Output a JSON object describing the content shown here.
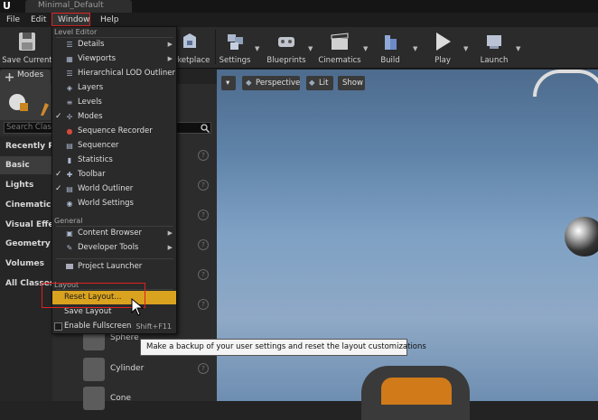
{
  "title_bar": {
    "logo": "U",
    "title": "Minimal_Default"
  },
  "menu": {
    "file": "File",
    "edit": "Edit",
    "window": "Window",
    "help": "Help"
  },
  "toolbar": {
    "save_current": "Save Current",
    "marketplace": "arketplace",
    "settings": "Settings",
    "blueprints": "Blueprints",
    "cinematics": "Cinematics",
    "build": "Build",
    "play": "Play",
    "launch": "Launch"
  },
  "modes": {
    "tab_label": "Modes",
    "search_placeholder": "Search Class",
    "categories": [
      "Recently Pla",
      "Basic",
      "Lights",
      "Cinematic",
      "Visual Effe",
      "Geometry",
      "Volumes",
      "All Classes"
    ],
    "items": [
      "Sphere",
      "Cylinder",
      "Cone"
    ]
  },
  "viewport": {
    "perspective": "Perspective",
    "lit": "Lit",
    "show": "Show"
  },
  "window_menu": {
    "level_editor_header": "Level Editor",
    "level_editor_items": [
      {
        "label": "Details",
        "checked": false,
        "submenu": true,
        "icon": "details-icon"
      },
      {
        "label": "Viewports",
        "checked": false,
        "submenu": true,
        "icon": "viewports-icon"
      },
      {
        "label": "Hierarchical LOD Outliner",
        "checked": false,
        "submenu": false,
        "icon": "hlod-icon"
      },
      {
        "label": "Layers",
        "checked": false,
        "submenu": false,
        "icon": "layers-icon"
      },
      {
        "label": "Levels",
        "checked": false,
        "submenu": false,
        "icon": "levels-icon"
      },
      {
        "label": "Modes",
        "checked": true,
        "submenu": false,
        "icon": "modes-icon"
      },
      {
        "label": "Sequence Recorder",
        "checked": false,
        "submenu": false,
        "icon": "record-icon"
      },
      {
        "label": "Sequencer",
        "checked": false,
        "submenu": false,
        "icon": "sequencer-icon"
      },
      {
        "label": "Statistics",
        "checked": false,
        "submenu": false,
        "icon": "statistics-icon"
      },
      {
        "label": "Toolbar",
        "checked": true,
        "submenu": false,
        "icon": "toolbar-icon"
      },
      {
        "label": "World Outliner",
        "checked": true,
        "submenu": false,
        "icon": "outliner-icon"
      },
      {
        "label": "World Settings",
        "checked": false,
        "submenu": false,
        "icon": "world-settings-icon"
      }
    ],
    "general_header": "General",
    "general_items": [
      {
        "label": "Content Browser",
        "submenu": true,
        "icon": "content-browser-icon"
      },
      {
        "label": "Developer Tools",
        "submenu": true,
        "icon": "developer-tools-icon"
      }
    ],
    "project_launcher": "Project Launcher",
    "layout_header": "Layout",
    "reset_layout": "Reset Layout...",
    "save_layout": "Save Layout",
    "enable_fullscreen": "Enable Fullscreen",
    "fullscreen_shortcut": "Shift+F11"
  },
  "tooltip": "Make a backup of your user settings and reset the layout customizations",
  "colors": {
    "highlight": "#d9a21f",
    "annotation_red": "#e02020",
    "menu_bg": "#2a2a2a"
  }
}
